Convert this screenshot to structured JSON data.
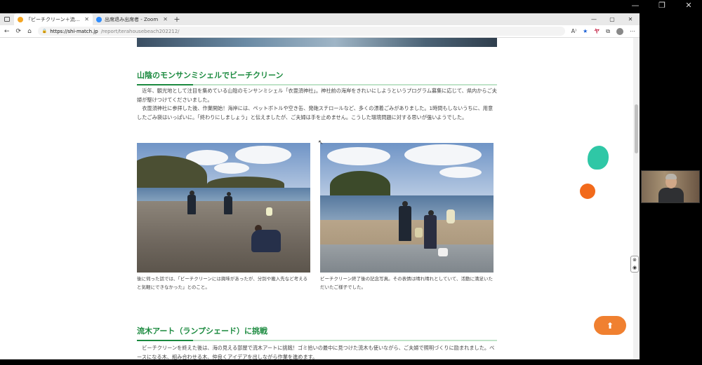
{
  "host_controls": {
    "minimize": "—",
    "restore": "❐",
    "close": "✕"
  },
  "tabs": [
    {
      "title": "「ビーチクリーン＋流木アート」開催い",
      "active": true,
      "favicon_color": "#f5a623"
    },
    {
      "title": "出席退み出席者 - Zoom",
      "active": false,
      "favicon_color": "#2d8cff"
    }
  ],
  "tab_close": "✕",
  "new_tab": "+",
  "address": {
    "host": "https://shi-match.jp",
    "path": "/report/terahousebeach202212/"
  },
  "window_buttons": {
    "minimize": "—",
    "maximize": "▢",
    "close": "✕"
  },
  "nav": {
    "back": "←",
    "refresh": "⟳",
    "home": "⌂",
    "lock": "🔒",
    "menu": "⋯",
    "read_aloud": "A⁾",
    "favorite": "★",
    "ext": "ヤ",
    "collections": "⧉"
  },
  "section1": {
    "title": "山陰のモンサンミシェルでビーチクリーン",
    "para": "　近年、観光地として注目を集めている山陰のモンサンミシェル「衣毘須神社」。神社前の海岸をきれいにしようというプログラム募集に応じて、県内からご夫婦が駆けつけてくださいました。\n　衣毘須神社に参拝した後、作業開始！海岸には、ペットボトルや空き缶、発砲スチロールなど、多くの漂着ごみがありました。1時間もしないうちに、用意したごみ袋はいっぱいに。「終わりにしましょう」と伝えましたが、ご夫婦は手を止めません。こうした環境問題に対する思いが強いようでした。"
  },
  "photos": [
    {
      "caption": "後に伺った話では、「ビーチクリーンには興味があったが、分別や搬入先など考えると気軽にできなかった」とのこと。"
    },
    {
      "caption": "ビーチクリーン終了後の記念写真。その表情は晴れ晴れとしていて、活動に満足いただいたご様子でした。"
    }
  ],
  "section2": {
    "title": "流木アート（ランプシェード）に挑戦",
    "para": "　ビーチクリーンを終えた後は、海の見える部屋で流木アートに挑戦！ゴミ拾いの最中に見つけた流木も使いながら、ご夫婦で照明づくりに励まれました。ベースになる木、組み合わせる木、仲良くアイデアを出しながら作業を進めます。"
  },
  "top_button": "⬆",
  "zoom_ctrl": {
    "top": "⊗",
    "bottom": "◉"
  },
  "colors": {
    "accent_green": "#1b8a3f",
    "blob_teal": "#2fc7a6",
    "blob_orange": "#f26a1b",
    "top_button": "#f08030"
  }
}
